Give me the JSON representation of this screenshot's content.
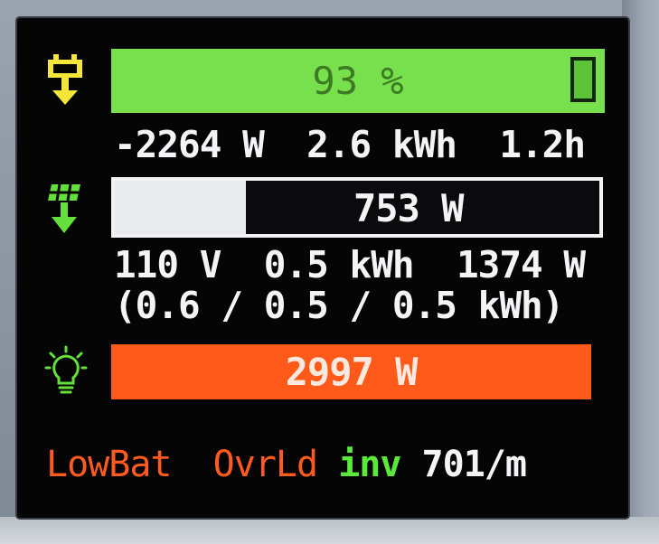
{
  "battery": {
    "percent_label": "93 %",
    "level_fraction": 0.93,
    "stats": "-2264 W  2.6 kWh  1.2h",
    "icon": "battery-down-arrow-icon",
    "color": "#78e04c"
  },
  "solar": {
    "power_label": "753 W",
    "fill_fraction": 0.27,
    "stats_line1": "110 V  0.5 kWh  1374 W",
    "stats_line2": "(0.6 / 0.5 / 0.5 kWh)",
    "icon": "solar-panel-down-arrow-icon",
    "color": "#e8eaec"
  },
  "load": {
    "power_label": "2997 W",
    "icon": "light-bulb-icon",
    "color": "#ff5a1a"
  },
  "status": {
    "low_bat": "LowBat",
    "overload": "OvrLd",
    "inverter": "inv",
    "rate": "701/m",
    "warning_color": "#ff5a20",
    "ok_color": "#5ae83a"
  }
}
